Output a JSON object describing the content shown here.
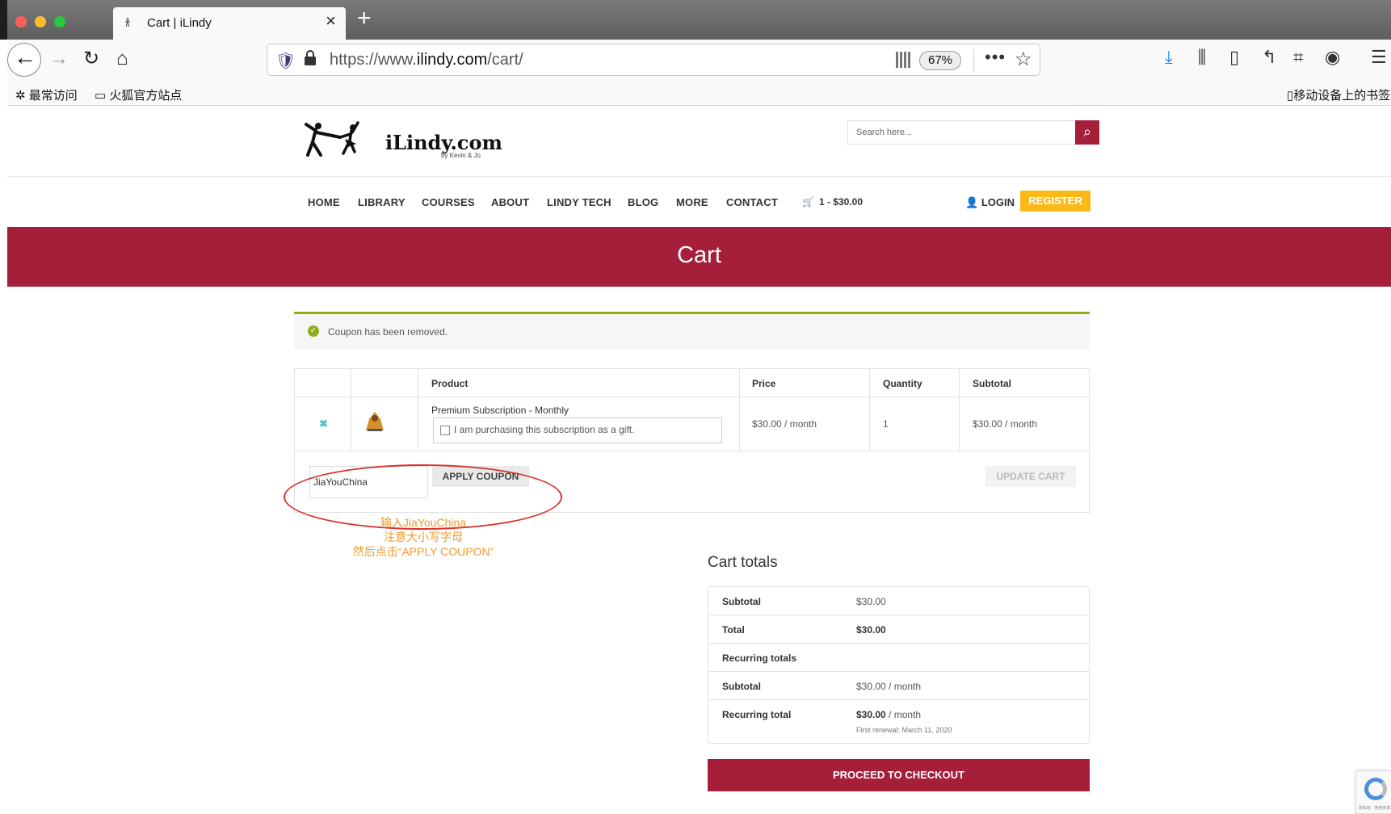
{
  "browser": {
    "tab_title": "Cart | iLindy",
    "tab_close": "×",
    "new_tab": "+",
    "url_prefix": "https://www.",
    "url_domain": "ilindy.com",
    "url_path": "/cart/",
    "zoom": "67%",
    "more": "•••",
    "bookmarks": [
      "最常访问",
      "火狐官方站点"
    ],
    "mobile_bookmarks": "移动设备上的书签"
  },
  "site": {
    "logo_name": "iLindy.com",
    "logo_sub": "by Kevin & Jo",
    "search_placeholder": "Search here...",
    "nav": [
      "HOME",
      "LIBRARY",
      "COURSES",
      "ABOUT",
      "LINDY TECH",
      "BLOG",
      "MORE",
      "CONTACT"
    ],
    "cart_summary": "1 - $30.00",
    "login": "LOGIN",
    "register": "REGISTER",
    "accent": "#a51e3a",
    "register_color": "#fbb917"
  },
  "page": {
    "title": "Cart",
    "notice": "Coupon has been removed.",
    "table": {
      "headers": [
        "Product",
        "Price",
        "Quantity",
        "Subtotal"
      ],
      "row": {
        "product": "Premium Subscription - Monthly",
        "gift_label": "I am purchasing this subscription as a gift.",
        "price": "$30.00 / month",
        "quantity": "1",
        "subtotal": "$30.00 / month"
      }
    },
    "coupon_value": "JiaYouChina",
    "apply_coupon": "APPLY COUPON",
    "update_cart": "UPDATE CART",
    "annotation": [
      "输入JiaYouChina",
      "注意大小写字母",
      "然后点击“APPLY COUPON”"
    ],
    "totals": {
      "title": "Cart totals",
      "subtotal_label": "Subtotal",
      "subtotal_value": "$30.00",
      "total_label": "Total",
      "total_value": "$30.00",
      "recurring_label": "Recurring totals",
      "rec_subtotal_label": "Subtotal",
      "rec_subtotal_value": "$30.00 / month",
      "rec_total_label": "Recurring total",
      "rec_total_amount": "$30.00",
      "rec_total_period": " / month",
      "first_renewal": "First renewal: March 11, 2020"
    },
    "checkout": "PROCEED TO CHECKOUT"
  },
  "recaptcha_text": "隐私权 - 使用条款"
}
